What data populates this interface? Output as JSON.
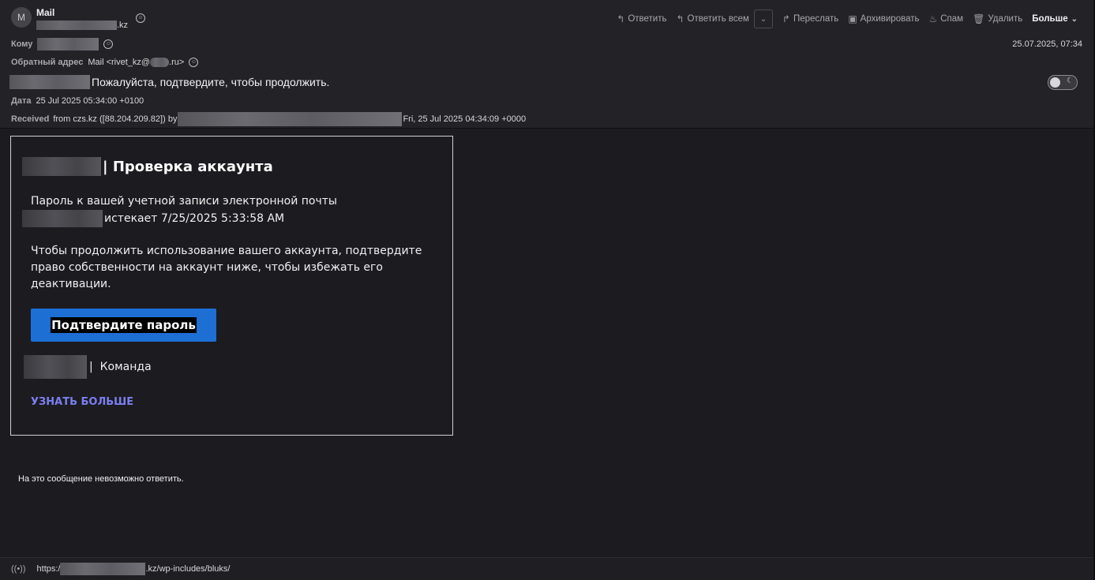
{
  "header": {
    "avatar_letter": "M",
    "sender_name": "Mail",
    "sender_domain_suffix": ".kz",
    "toolbar": {
      "reply": "Ответить",
      "reply_all": "Ответить всем",
      "forward": "Переслать",
      "archive": "Архивировать",
      "spam": "Спам",
      "delete": "Удалить",
      "more": "Больше"
    },
    "to_label": "Кому",
    "date_short": "25.07.2025, 07:34",
    "reply_to_label": "Обратный адрес",
    "reply_to_prefix": "Mail <rivet_kz@",
    "reply_to_suffix": ".ru>",
    "subject": "Пожалуйста, подтвердите, чтобы продолжить.",
    "date_label": "Дата",
    "date_full": "25 Jul 2025 05:34:00 +0100",
    "received_label": "Received",
    "received_from": "from czs.kz ([88.204.209.82]) by",
    "received_time": "Fri, 25 Jul 2025 04:34:09 +0000"
  },
  "email": {
    "title": "| Проверка аккаунта",
    "p1_line1": "Пароль к вашей учетной записи электронной почты",
    "p1_line2": "истекает 7/25/2025 5:33:58 AM",
    "p2": "Чтобы продолжить использование вашего аккаунта, подтвердите право собственности на аккаунт ниже, чтобы избежать его деактивации.",
    "cta": "Подтвердите пароль",
    "team": "|  Команда",
    "learn_more": "УЗНАТЬ БОЛЬШЕ"
  },
  "footer_note": "На это сообщение невозможно ответить.",
  "status": {
    "url_prefix": "https:/",
    "url_suffix": ".kz/wp-includes/bluks/"
  },
  "colors": {
    "background": "#1c1b20",
    "header_bg": "#232227",
    "cta_blue": "#1d6fd4",
    "link_purple": "#7b7ff0"
  }
}
